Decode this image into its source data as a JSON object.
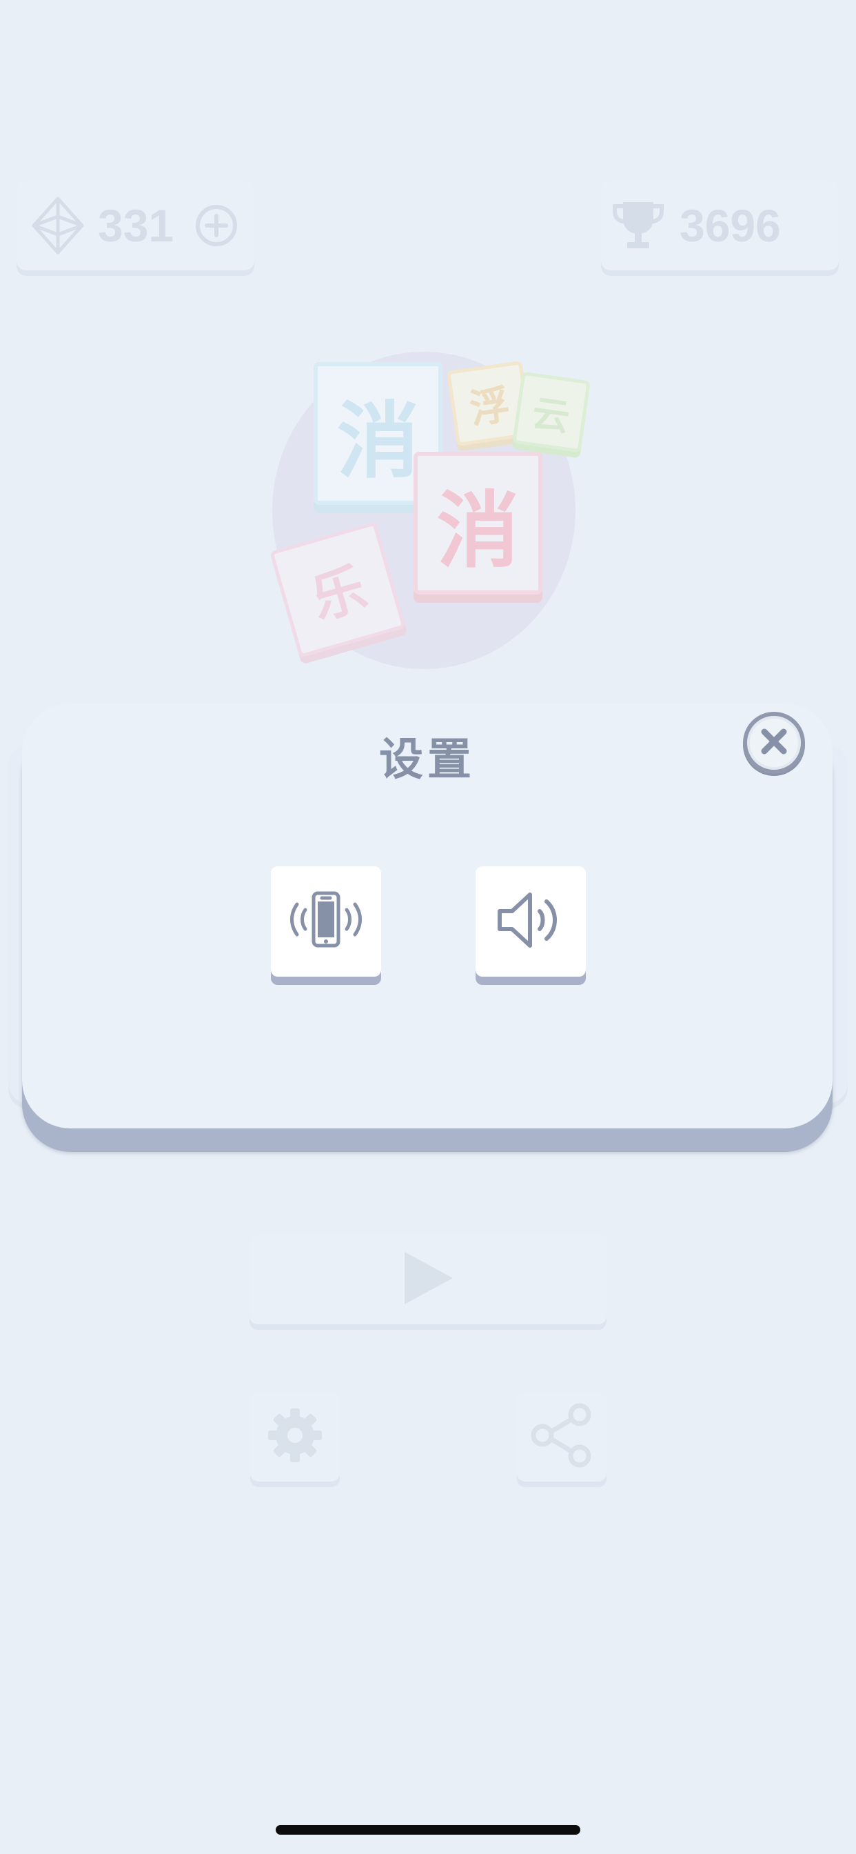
{
  "stats": {
    "gems": "331",
    "trophies": "3696"
  },
  "logo": {
    "tiles": [
      "消",
      "消",
      "浮",
      "云",
      "乐"
    ]
  },
  "settings_modal": {
    "title": "设置",
    "vibration_icon": "vibrating-phone-icon",
    "sound_icon": "speaker-icon",
    "close_icon": "close-icon"
  },
  "icons": {
    "gem": "gem-icon",
    "add": "plus-circle-icon",
    "trophy": "trophy-icon",
    "play": "play-icon",
    "settings": "gear-icon",
    "share": "share-icon"
  },
  "colors": {
    "background": "#e8eff7",
    "modal": "#eaf1f8",
    "modal_shadow": "#a9b4ca",
    "icon": "#8690a6",
    "faded": "#d4dde8"
  }
}
